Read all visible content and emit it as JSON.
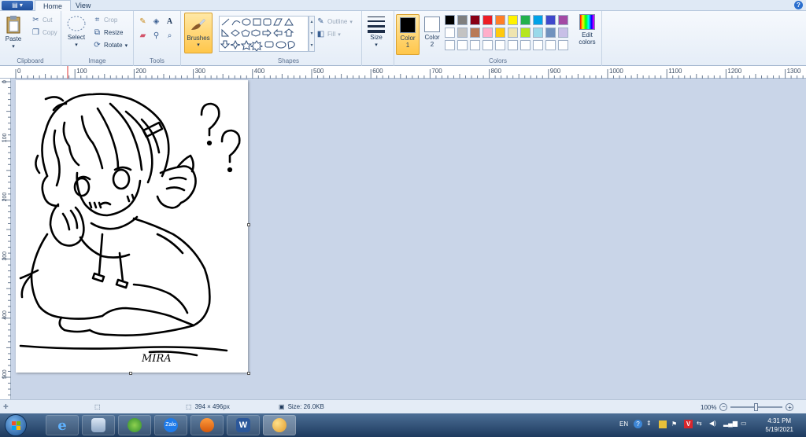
{
  "tabs": {
    "home": "Home",
    "view": "View"
  },
  "clipboard": {
    "paste": "Paste",
    "cut": "Cut",
    "copy": "Copy",
    "label": "Clipboard"
  },
  "image": {
    "select": "Select",
    "crop": "Crop",
    "resize": "Resize",
    "rotate": "Rotate",
    "label": "Image"
  },
  "tools": {
    "label": "Tools",
    "text_glyph": "A"
  },
  "brushes": {
    "label": "Brushes"
  },
  "shapes": {
    "outline": "Outline",
    "fill": "Fill",
    "label": "Shapes"
  },
  "size": {
    "label": "Size"
  },
  "color1": {
    "label_line1": "Color",
    "label_line2": "1",
    "value": "#000000"
  },
  "color2": {
    "label_line1": "Color",
    "label_line2": "2",
    "value": "#ffffff"
  },
  "colors": {
    "label": "Colors",
    "edit": "Edit colors",
    "palette_row1": [
      "#000000",
      "#7f7f7f",
      "#880015",
      "#ed1c24",
      "#ff7f27",
      "#fff200",
      "#22b14c",
      "#00a2e8",
      "#3f48cc",
      "#a349a4"
    ],
    "palette_row2": [
      "#ffffff",
      "#c3c3c3",
      "#b97a57",
      "#ffaec9",
      "#ffc90e",
      "#efe4b0",
      "#b5e61d",
      "#99d9ea",
      "#7092be",
      "#c8bfe7"
    ]
  },
  "ruler": {
    "h_ticks": [
      "0",
      "100",
      "200",
      "300",
      "400",
      "500",
      "600",
      "700",
      "800",
      "900",
      "1000",
      "1100",
      "1200",
      "1300"
    ],
    "v_ticks": [
      "0",
      "100",
      "200",
      "300",
      "400",
      "500"
    ]
  },
  "canvas": {
    "signature": "MIRA"
  },
  "status": {
    "dimensions": "394 × 496px",
    "size": "Size: 26.0KB",
    "zoom": "100%"
  },
  "tray": {
    "lang": "EN",
    "time": "4:31 PM",
    "date": "5/19/2021"
  },
  "taskbar": {
    "zalo": "Zalo"
  }
}
